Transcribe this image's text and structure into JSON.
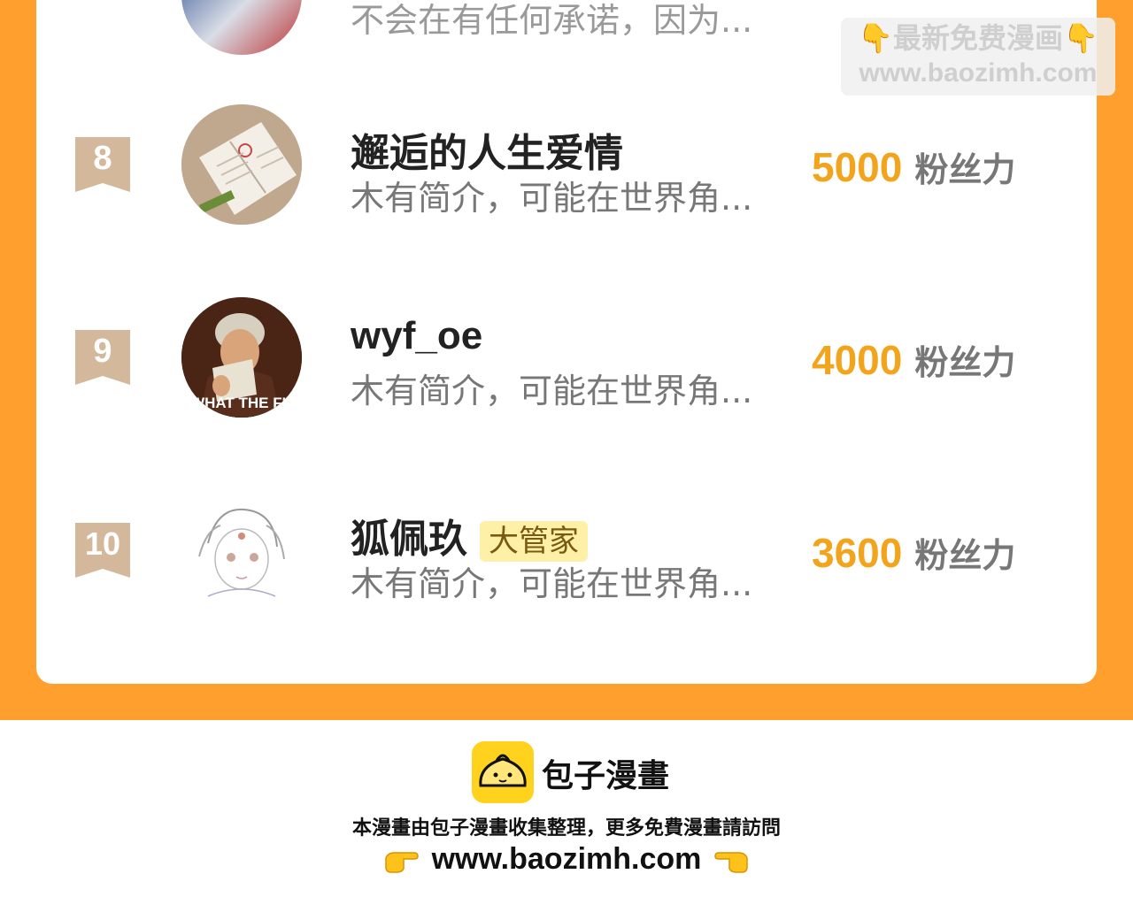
{
  "top_partial": {
    "desc": "不会在有任何承诺，因为..."
  },
  "rows": [
    {
      "rank": "8",
      "name": "邂逅的人生爱情",
      "badge": "",
      "desc": "木有简介，可能在世界角...",
      "score": "5000",
      "unit": "粉丝力"
    },
    {
      "rank": "9",
      "name": "wyf_oe",
      "badge": "",
      "desc": "木有简介，可能在世界角...",
      "score": "4000",
      "unit": "粉丝力"
    },
    {
      "rank": "10",
      "name": "狐佩玖",
      "badge": "大管家",
      "desc": "木有简介，可能在世界角...",
      "score": "3600",
      "unit": "粉丝力"
    }
  ],
  "avatar_texts": {
    "meme": "WHAT THE FU"
  },
  "watermark": {
    "line1": "👇最新免费漫画👇",
    "line2": "www.baozimh.com"
  },
  "footer": {
    "brand": "包子漫畫",
    "text": "本漫畫由包子漫畫收集整理，更多免費漫畫請訪問",
    "url": "www.baozimh.com"
  },
  "colors": {
    "accent": "#FFA02E",
    "score": "#F2A51C",
    "rank_badge": "#D4B89C",
    "admin_badge": "#FFF0A8"
  }
}
